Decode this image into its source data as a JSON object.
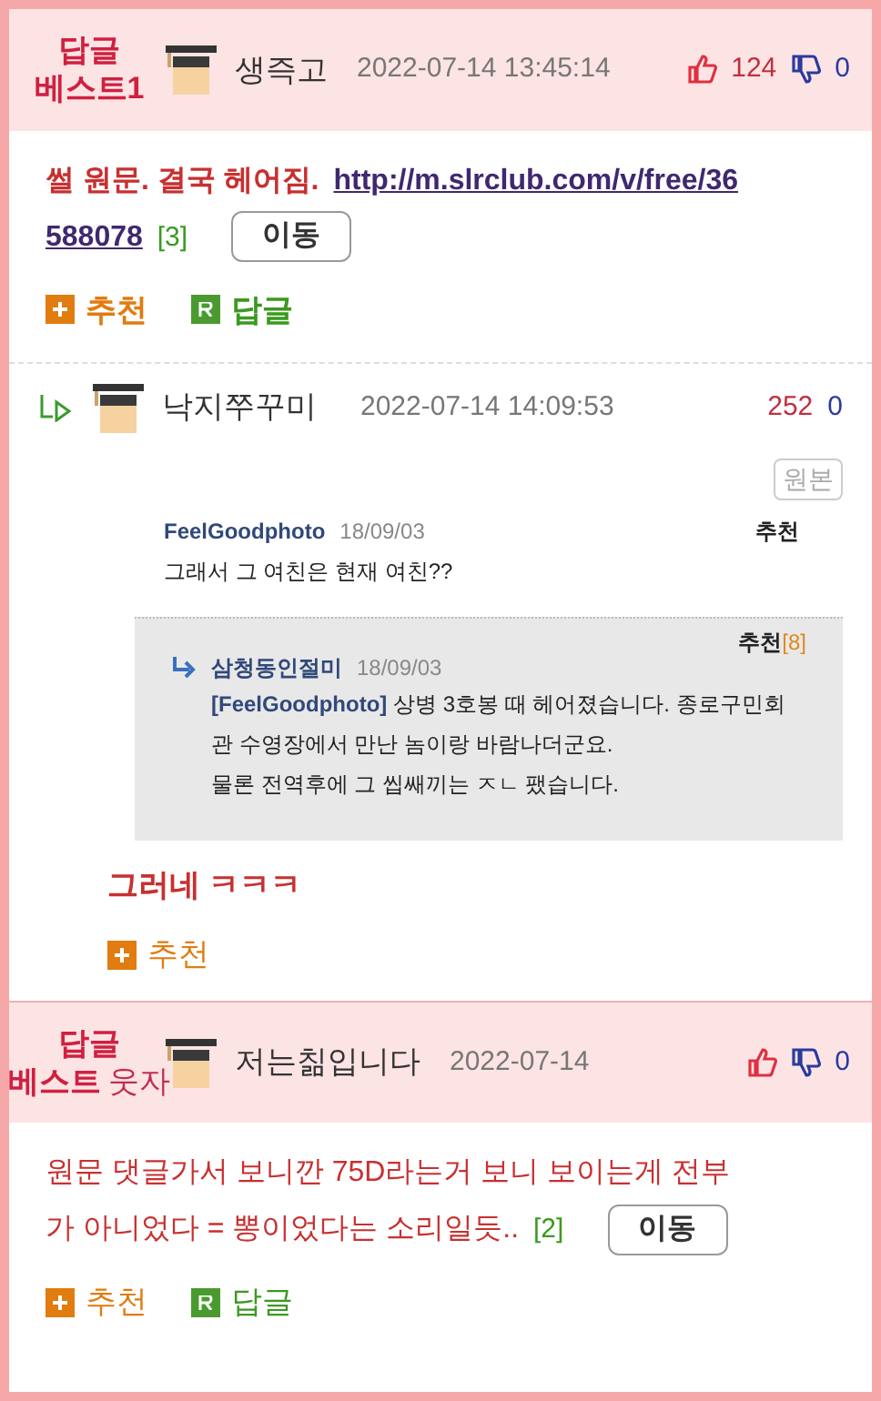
{
  "comments": [
    {
      "kind": "best",
      "badge": [
        "답글",
        "베스트1"
      ],
      "nickname": "생즉고",
      "time": "2022-07-14 13:45:14",
      "likes": "124",
      "dislikes": "0",
      "emphasis": true,
      "text": "썰 원문. 결국 헤어짐.",
      "link": [
        "http://m.slrclub.com/v/free/36",
        "588078"
      ],
      "count": "[3]",
      "move": "이동",
      "actions": [
        {
          "kind": "recommend",
          "label": "추천"
        },
        {
          "kind": "reply",
          "label": "답글"
        }
      ]
    },
    {
      "kind": "reply",
      "nickname": "낙지쭈꾸미",
      "time": "2022-07-14 14:09:53",
      "likes": "252",
      "dislikes": "0",
      "source": "원본",
      "quote": {
        "author": "FeelGoodphoto",
        "date": "18/09/03",
        "recommend": "추천",
        "text": "그래서 그 여친은 현재 여친??"
      },
      "nested": {
        "author": "삼청동인절미",
        "date": "18/09/03",
        "recommend": "추천",
        "recommend_count": "[8]",
        "mention": "[FeelGoodphoto]",
        "lines": [
          "상병 3호봉 때 헤어졌습니다. 종로구민회관 수영장에서 만난 놈이랑 바람나더군요.",
          "물론 전역후에 그 씹쌔끼는 ㅈㄴ 팼습니다."
        ]
      },
      "text": "그러네 ㅋㅋㅋ",
      "actions": [
        {
          "kind": "recommend",
          "label": "추천"
        }
      ]
    },
    {
      "kind": "best",
      "badge": [
        "답글",
        "베스트"
      ],
      "tag": "웃자",
      "nickname": "저는칢입니다",
      "time": "2022-07-14",
      "dislikes": "0",
      "emphasis": false,
      "text_lines": [
        "원문 댓글가서 보니깐 75D라는거 보니 보이는게 전부",
        "가 아니었다 = 뽕이었다는 소리일듯.."
      ],
      "count": "[2]",
      "move": "이동",
      "actions": [
        {
          "kind": "recommend",
          "label": "추천"
        },
        {
          "kind": "reply",
          "label": "답글"
        }
      ]
    }
  ]
}
